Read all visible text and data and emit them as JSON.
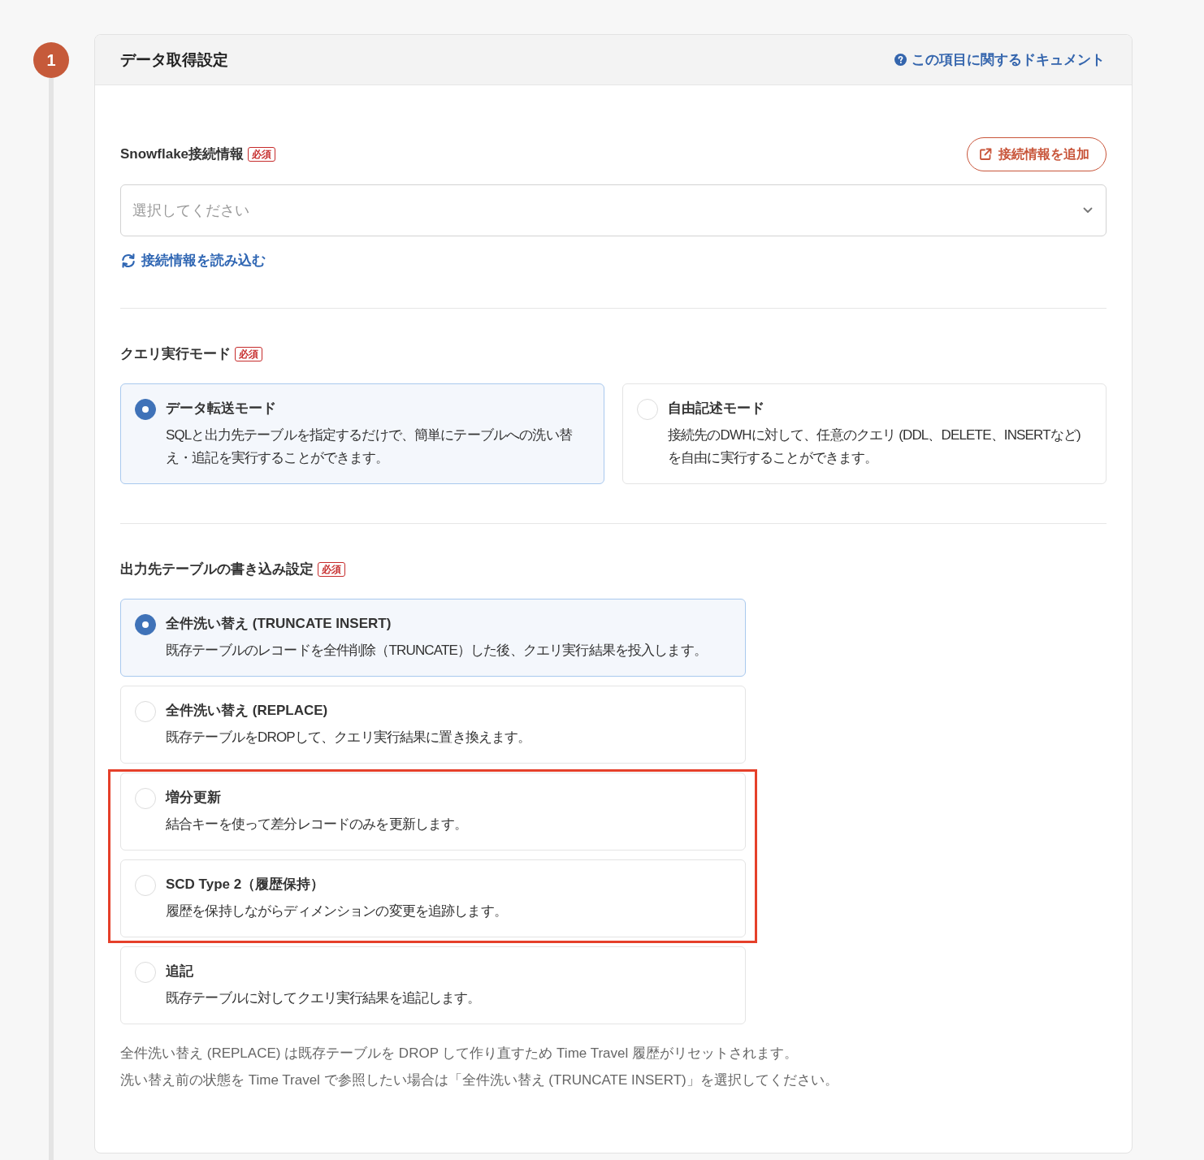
{
  "step": {
    "number": "1"
  },
  "section": {
    "title": "データ取得設定",
    "doc_link": "この項目に関するドキュメント"
  },
  "connection": {
    "label": "Snowflake接続情報",
    "badge": "必須",
    "add_button": "接続情報を追加",
    "select": {
      "placeholder": "選択してください"
    },
    "reload_link": "接続情報を読み込む"
  },
  "query_mode": {
    "label": "クエリ実行モード",
    "badge": "必須",
    "options": [
      {
        "title": "データ転送モード",
        "description": "SQLと出力先テーブルを指定するだけで、簡単にテーブルへの洗い替え・追記を実行することができます。",
        "selected": true
      },
      {
        "title": "自由記述モード",
        "description": "接続先のDWHに対して、任意のクエリ (DDL、DELETE、INSERTなど) を自由に実行することができます。",
        "selected": false
      }
    ]
  },
  "write_mode": {
    "label": "出力先テーブルの書き込み設定",
    "badge": "必須",
    "options": [
      {
        "title": "全件洗い替え (TRUNCATE INSERT)",
        "description": "既存テーブルのレコードを全件削除（TRUNCATE）した後、クエリ実行結果を投入します。",
        "selected": true,
        "highlighted": false
      },
      {
        "title": "全件洗い替え (REPLACE)",
        "description": "既存テーブルをDROPして、クエリ実行結果に置き換えます。",
        "selected": false,
        "highlighted": false
      },
      {
        "title": "増分更新",
        "description": "結合キーを使って差分レコードのみを更新します。",
        "selected": false,
        "highlighted": true
      },
      {
        "title": "SCD Type 2（履歴保持）",
        "description": "履歴を保持しながらディメンションの変更を追跡します。",
        "selected": false,
        "highlighted": true
      },
      {
        "title": "追記",
        "description": "既存テーブルに対してクエリ実行結果を追記します。",
        "selected": false,
        "highlighted": false
      }
    ],
    "notes": [
      "全件洗い替え (REPLACE) は既存テーブルを DROP して作り直すため Time Travel 履歴がリセットされます。",
      "洗い替え前の状態を Time Travel で参照したい場合は「全件洗い替え (TRUNCATE INSERT)」を選択してください。"
    ]
  }
}
